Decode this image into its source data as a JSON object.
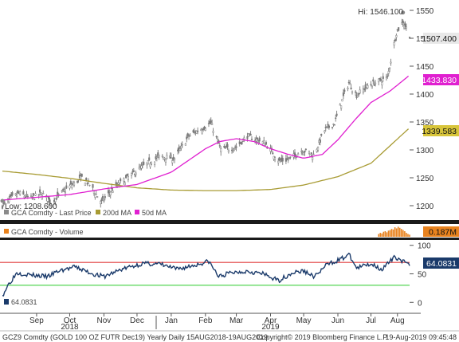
{
  "chart_data": [
    {
      "type": "candlestick",
      "ylim": [
        1180,
        1560
      ],
      "yticks": [
        1200,
        1250,
        1300,
        1350,
        1400,
        1450,
        1500,
        1550
      ],
      "grid": false,
      "x_range": [
        "2018-08-15",
        "2019-08-19"
      ],
      "high_label": "Hi: 1546.100",
      "low_label": "Low: 1208.600",
      "high_value": 1546.1,
      "low_value": 1208.6,
      "legend": [
        "GCA Comdty - Last Price",
        "200d MA",
        "50d MA"
      ],
      "series_colors": {
        "price": "#8a8a8a",
        "ma200": "#a89b33",
        "ma50": "#e020d0"
      },
      "last_price": {
        "label": "1507.400",
        "value": 1507.4,
        "color": "#e8e8e8"
      },
      "ma50_last": {
        "label": "1433.830",
        "value": 1433.83,
        "color": "#e020d0"
      },
      "ma200_last": {
        "label": "1339.583",
        "value": 1339.583,
        "color": "#d8c53a"
      },
      "price_anchors": [
        [
          "2018-08-15",
          1200
        ],
        [
          "2018-08-22",
          1212
        ],
        [
          "2018-08-30",
          1222
        ],
        [
          "2018-09-10",
          1213
        ],
        [
          "2018-09-20",
          1222
        ],
        [
          "2018-09-28",
          1206
        ],
        [
          "2018-10-12",
          1230
        ],
        [
          "2018-10-26",
          1250
        ],
        [
          "2018-11-02",
          1238
        ],
        [
          "2018-11-13",
          1206
        ],
        [
          "2018-11-22",
          1228
        ],
        [
          "2018-12-05",
          1248
        ],
        [
          "2018-12-20",
          1270
        ],
        [
          "2019-01-04",
          1288
        ],
        [
          "2019-01-18",
          1285
        ],
        [
          "2019-01-31",
          1325
        ],
        [
          "2019-02-20",
          1348
        ],
        [
          "2019-03-01",
          1300
        ],
        [
          "2019-03-15",
          1305
        ],
        [
          "2019-03-25",
          1325
        ],
        [
          "2019-04-10",
          1312
        ],
        [
          "2019-04-23",
          1280
        ],
        [
          "2019-05-02",
          1283
        ],
        [
          "2019-05-14",
          1300
        ],
        [
          "2019-05-24",
          1290
        ],
        [
          "2019-06-03",
          1335
        ],
        [
          "2019-06-12",
          1348
        ],
        [
          "2019-06-20",
          1395
        ],
        [
          "2019-06-25",
          1420
        ],
        [
          "2019-07-02",
          1398
        ],
        [
          "2019-07-12",
          1415
        ],
        [
          "2019-07-25",
          1425
        ],
        [
          "2019-07-30",
          1430
        ],
        [
          "2019-08-07",
          1510
        ],
        [
          "2019-08-13",
          1530
        ],
        [
          "2019-08-19",
          1507
        ]
      ],
      "ma50_anchors": [
        [
          "2018-08-15",
          1210
        ],
        [
          "2018-09-15",
          1215
        ],
        [
          "2018-10-15",
          1220
        ],
        [
          "2018-11-15",
          1230
        ],
        [
          "2018-12-15",
          1238
        ],
        [
          "2019-01-15",
          1260
        ],
        [
          "2019-02-15",
          1302
        ],
        [
          "2019-02-28",
          1315
        ],
        [
          "2019-03-15",
          1320
        ],
        [
          "2019-03-31",
          1315
        ],
        [
          "2019-04-15",
          1302
        ],
        [
          "2019-05-01",
          1292
        ],
        [
          "2019-05-15",
          1285
        ],
        [
          "2019-06-01",
          1292
        ],
        [
          "2019-06-15",
          1318
        ],
        [
          "2019-07-01",
          1355
        ],
        [
          "2019-07-15",
          1385
        ],
        [
          "2019-08-01",
          1405
        ],
        [
          "2019-08-19",
          1433.83
        ]
      ],
      "ma200_anchors": [
        [
          "2018-08-15",
          1262
        ],
        [
          "2018-09-15",
          1256
        ],
        [
          "2018-10-15",
          1249
        ],
        [
          "2018-11-15",
          1240
        ],
        [
          "2018-12-15",
          1232
        ],
        [
          "2019-01-15",
          1228
        ],
        [
          "2019-02-15",
          1227
        ],
        [
          "2019-03-15",
          1227
        ],
        [
          "2019-04-15",
          1229
        ],
        [
          "2019-05-15",
          1237
        ],
        [
          "2019-06-15",
          1252
        ],
        [
          "2019-07-15",
          1276
        ],
        [
          "2019-08-19",
          1339.583
        ]
      ]
    },
    {
      "type": "bar",
      "legend": [
        "GCA Comdty - Volume"
      ],
      "color": "#e8821e",
      "last_label": "0.187M",
      "last_value": 0.187,
      "unit": "M",
      "ylim": [
        0,
        1
      ],
      "note": "volume bars appear only for the last ~4 weeks",
      "recent_volumes": [
        0.25,
        0.35,
        0.3,
        0.45,
        0.5,
        0.4,
        0.55,
        0.6,
        0.7,
        0.65,
        0.85,
        0.75,
        0.9,
        0.8,
        0.7,
        0.6,
        0.5,
        0.35,
        0.25,
        0.187
      ]
    },
    {
      "type": "line",
      "indicator": "RSI",
      "last_label": "64.0831",
      "last_value": 64.0831,
      "ylim": [
        -15,
        108
      ],
      "yticks": [
        0,
        50,
        100
      ],
      "overbought": 70,
      "oversold": 30,
      "colors": {
        "line": "#1a3a6a",
        "overbought": "#e03a3a",
        "oversold": "#40d040"
      },
      "anchors": [
        [
          "2018-08-15",
          12
        ],
        [
          "2018-08-20",
          30
        ],
        [
          "2018-08-28",
          52
        ],
        [
          "2018-09-10",
          48
        ],
        [
          "2018-09-25",
          45
        ],
        [
          "2018-10-05",
          55
        ],
        [
          "2018-10-20",
          62
        ],
        [
          "2018-11-05",
          50
        ],
        [
          "2018-11-15",
          45
        ],
        [
          "2018-12-01",
          58
        ],
        [
          "2018-12-20",
          68
        ],
        [
          "2019-01-05",
          67
        ],
        [
          "2019-01-20",
          58
        ],
        [
          "2019-02-05",
          65
        ],
        [
          "2019-02-18",
          72
        ],
        [
          "2019-02-27",
          45
        ],
        [
          "2019-03-10",
          52
        ],
        [
          "2019-03-25",
          55
        ],
        [
          "2019-04-08",
          50
        ],
        [
          "2019-04-22",
          38
        ],
        [
          "2019-05-05",
          52
        ],
        [
          "2019-05-15",
          55
        ],
        [
          "2019-05-25",
          45
        ],
        [
          "2019-06-05",
          66
        ],
        [
          "2019-06-20",
          78
        ],
        [
          "2019-06-25",
          84
        ],
        [
          "2019-07-02",
          60
        ],
        [
          "2019-07-15",
          68
        ],
        [
          "2019-07-25",
          58
        ],
        [
          "2019-08-06",
          80
        ],
        [
          "2019-08-13",
          72
        ],
        [
          "2019-08-19",
          64.08
        ]
      ]
    }
  ],
  "x_axis": {
    "months": [
      {
        "label": "Sep",
        "date": "2018-09-15"
      },
      {
        "label": "Oct",
        "date": "2018-10-15"
      },
      {
        "label": "Nov",
        "date": "2018-11-15"
      },
      {
        "label": "Dec",
        "date": "2018-12-15"
      },
      {
        "label": "Jan",
        "date": "2019-01-15"
      },
      {
        "label": "Feb",
        "date": "2019-02-15"
      },
      {
        "label": "Mar",
        "date": "2019-03-15"
      },
      {
        "label": "Apr",
        "date": "2019-04-15"
      },
      {
        "label": "May",
        "date": "2019-05-15"
      },
      {
        "label": "Jun",
        "date": "2019-06-15"
      },
      {
        "label": "Jul",
        "date": "2019-07-15"
      },
      {
        "label": "Aug",
        "date": "2019-08-08"
      }
    ],
    "years": [
      {
        "label": "2018",
        "date": "2018-10-15"
      },
      {
        "label": "2019",
        "date": "2019-04-15"
      }
    ]
  },
  "footer": {
    "left": "GCZ9 Comdty (GOLD 100 OZ FUTR  Dec19) Yearly  Daily 15AUG2018-19AUG2019",
    "copyright": "Copyright© 2019 Bloomberg Finance L.P.",
    "timestamp": "19-Aug-2019 09:45:48"
  }
}
